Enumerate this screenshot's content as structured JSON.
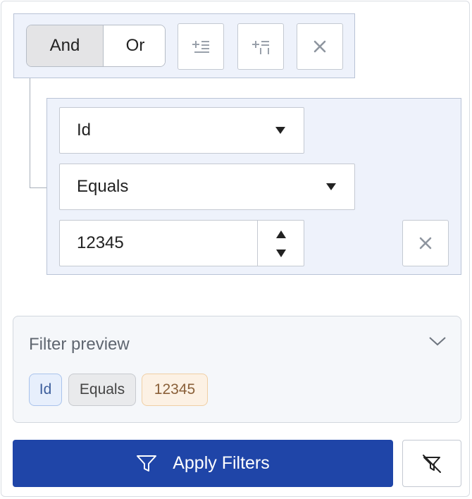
{
  "group": {
    "combinator_options": [
      {
        "label": "And",
        "selected": true
      },
      {
        "label": "Or",
        "selected": false
      }
    ],
    "actions": [
      {
        "icon": "add-rule-icon"
      },
      {
        "icon": "add-group-icon"
      },
      {
        "icon": "close-icon"
      }
    ]
  },
  "rule": {
    "field": "Id",
    "operator": "Equals",
    "value": "12345",
    "remove_icon": "close-icon"
  },
  "preview": {
    "title": "Filter preview",
    "toggle_icon": "chevron-down-icon",
    "chips": {
      "field": "Id",
      "operator": "Equals",
      "value": "12345"
    }
  },
  "footer": {
    "apply_label": "Apply Filters",
    "apply_icon": "filter-icon",
    "clear_icon": "clear-filter-icon"
  },
  "colors": {
    "accent": "#1f45a8",
    "panel_bg": "#eef2fb",
    "chip_field_bg": "#e7effc",
    "chip_value_bg": "#fcf1e4"
  }
}
